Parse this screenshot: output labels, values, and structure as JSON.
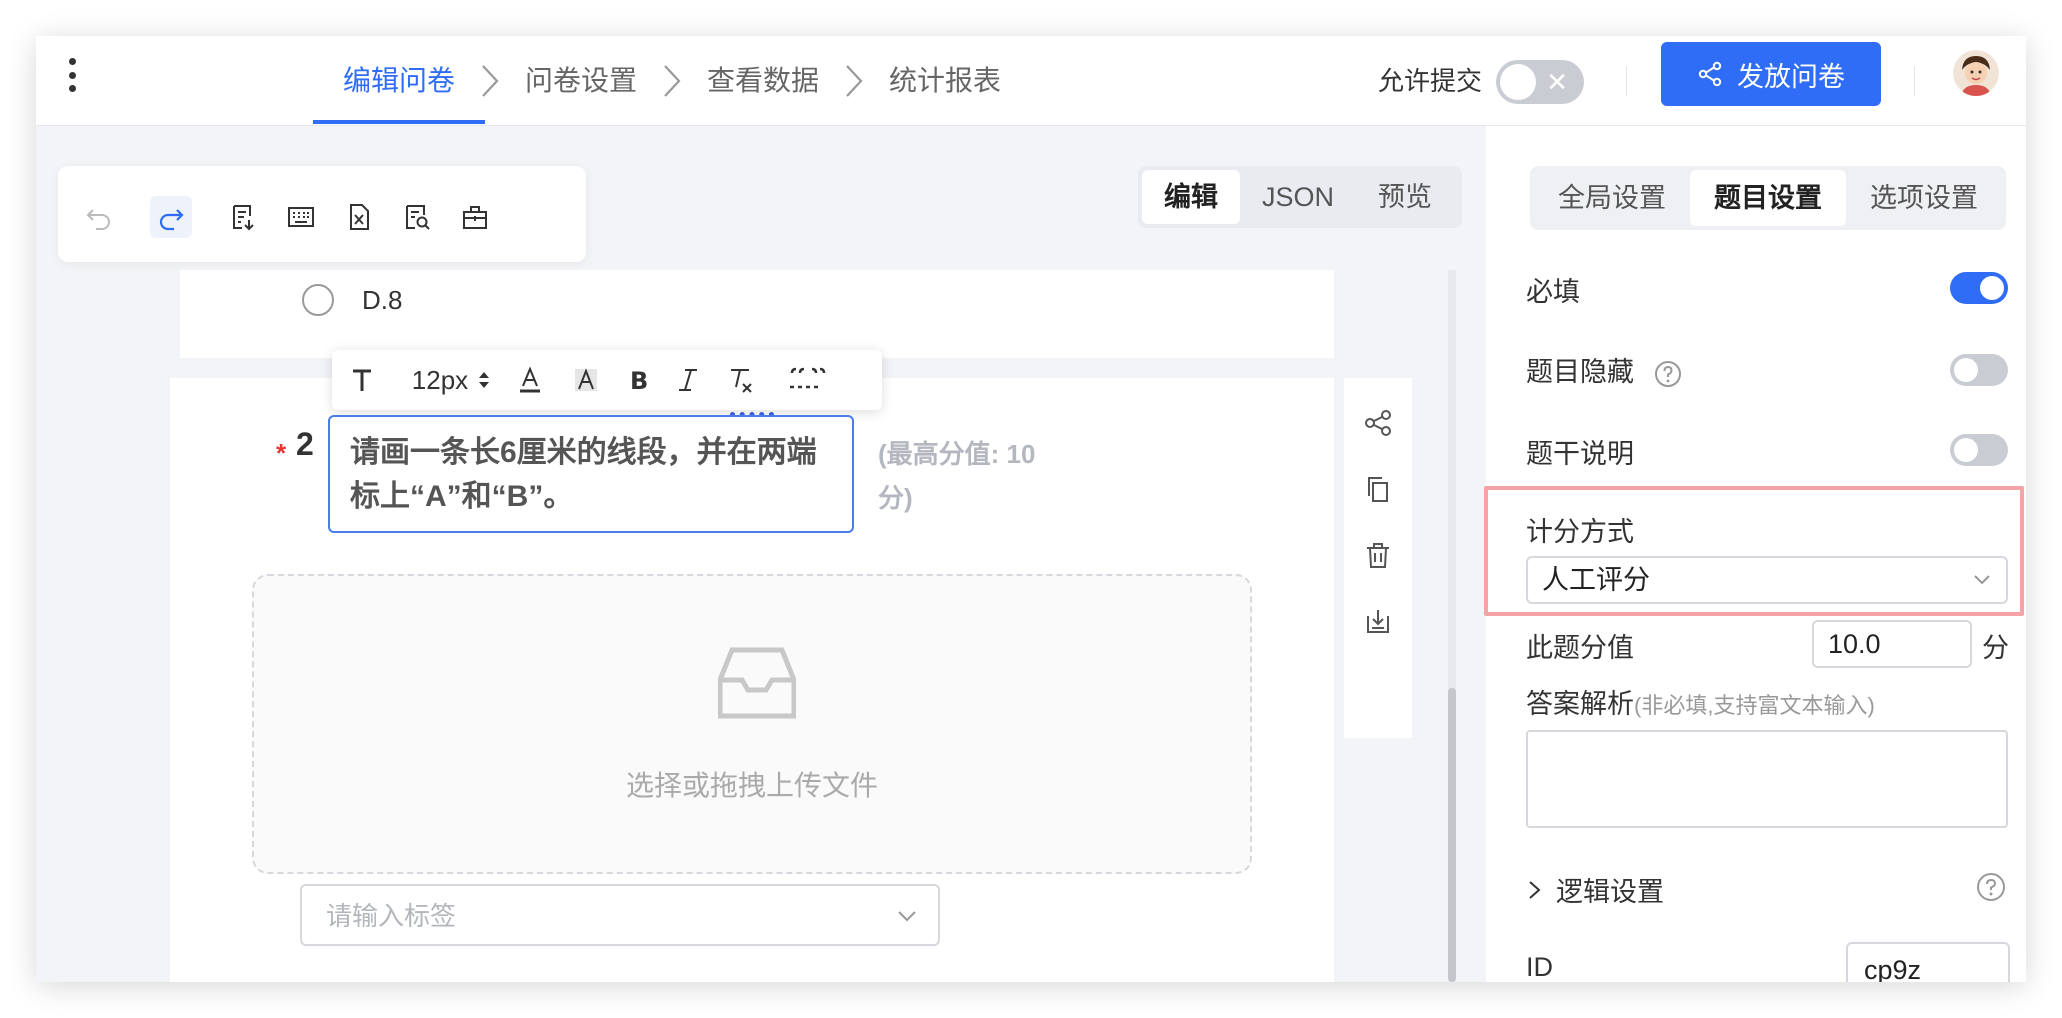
{
  "header": {
    "steps": [
      {
        "label": "编辑问卷",
        "active": true
      },
      {
        "label": "问卷设置",
        "active": false
      },
      {
        "label": "查看数据",
        "active": false
      },
      {
        "label": "统计报表",
        "active": false
      }
    ],
    "allow_submit_label": "允许提交",
    "allow_submit_enabled": false,
    "publish_label": "发放问卷"
  },
  "toolbar": {
    "icons": [
      "undo-icon",
      "redo-icon",
      "add-question-icon",
      "keyboard-icon",
      "excel-import-icon",
      "preview-doc-icon",
      "toolbox-icon"
    ]
  },
  "mode_tabs": [
    {
      "label": "编辑",
      "active": true
    },
    {
      "label": "JSON",
      "active": false
    },
    {
      "label": "预览",
      "active": false
    }
  ],
  "prev_question": {
    "option_label": "D.8"
  },
  "rich_text_toolbar": {
    "font_size": "12px"
  },
  "question": {
    "required_mark": "*",
    "number": "2",
    "title": "请画一条长6厘米的线段，并在两端标上“A”和“B”。",
    "max_score_hint": "(最高分值: 10分)",
    "upload_text": "选择或拖拽上传文件",
    "tag_placeholder": "请输入标签"
  },
  "settings_panel": {
    "tabs": [
      {
        "label": "全局设置",
        "active": false
      },
      {
        "label": "题目设置",
        "active": true
      },
      {
        "label": "选项设置",
        "active": false
      }
    ],
    "required_label": "必填",
    "required_on": true,
    "hide_label": "题目隐藏",
    "hide_on": false,
    "desc_label": "题干说明",
    "desc_on": false,
    "scoring_label": "计分方式",
    "scoring_value": "人工评分",
    "score_label": "此题分值",
    "score_value": "10.0",
    "score_unit": "分",
    "analysis_label": "答案解析",
    "analysis_hint": "(非必填,支持富文本输入)",
    "logic_label": "逻辑设置",
    "id_label": "ID",
    "id_value": "cp9z"
  },
  "colors": {
    "accent": "#2f6df6",
    "highlight_border": "#f4a3a7",
    "required": "#e33333"
  }
}
